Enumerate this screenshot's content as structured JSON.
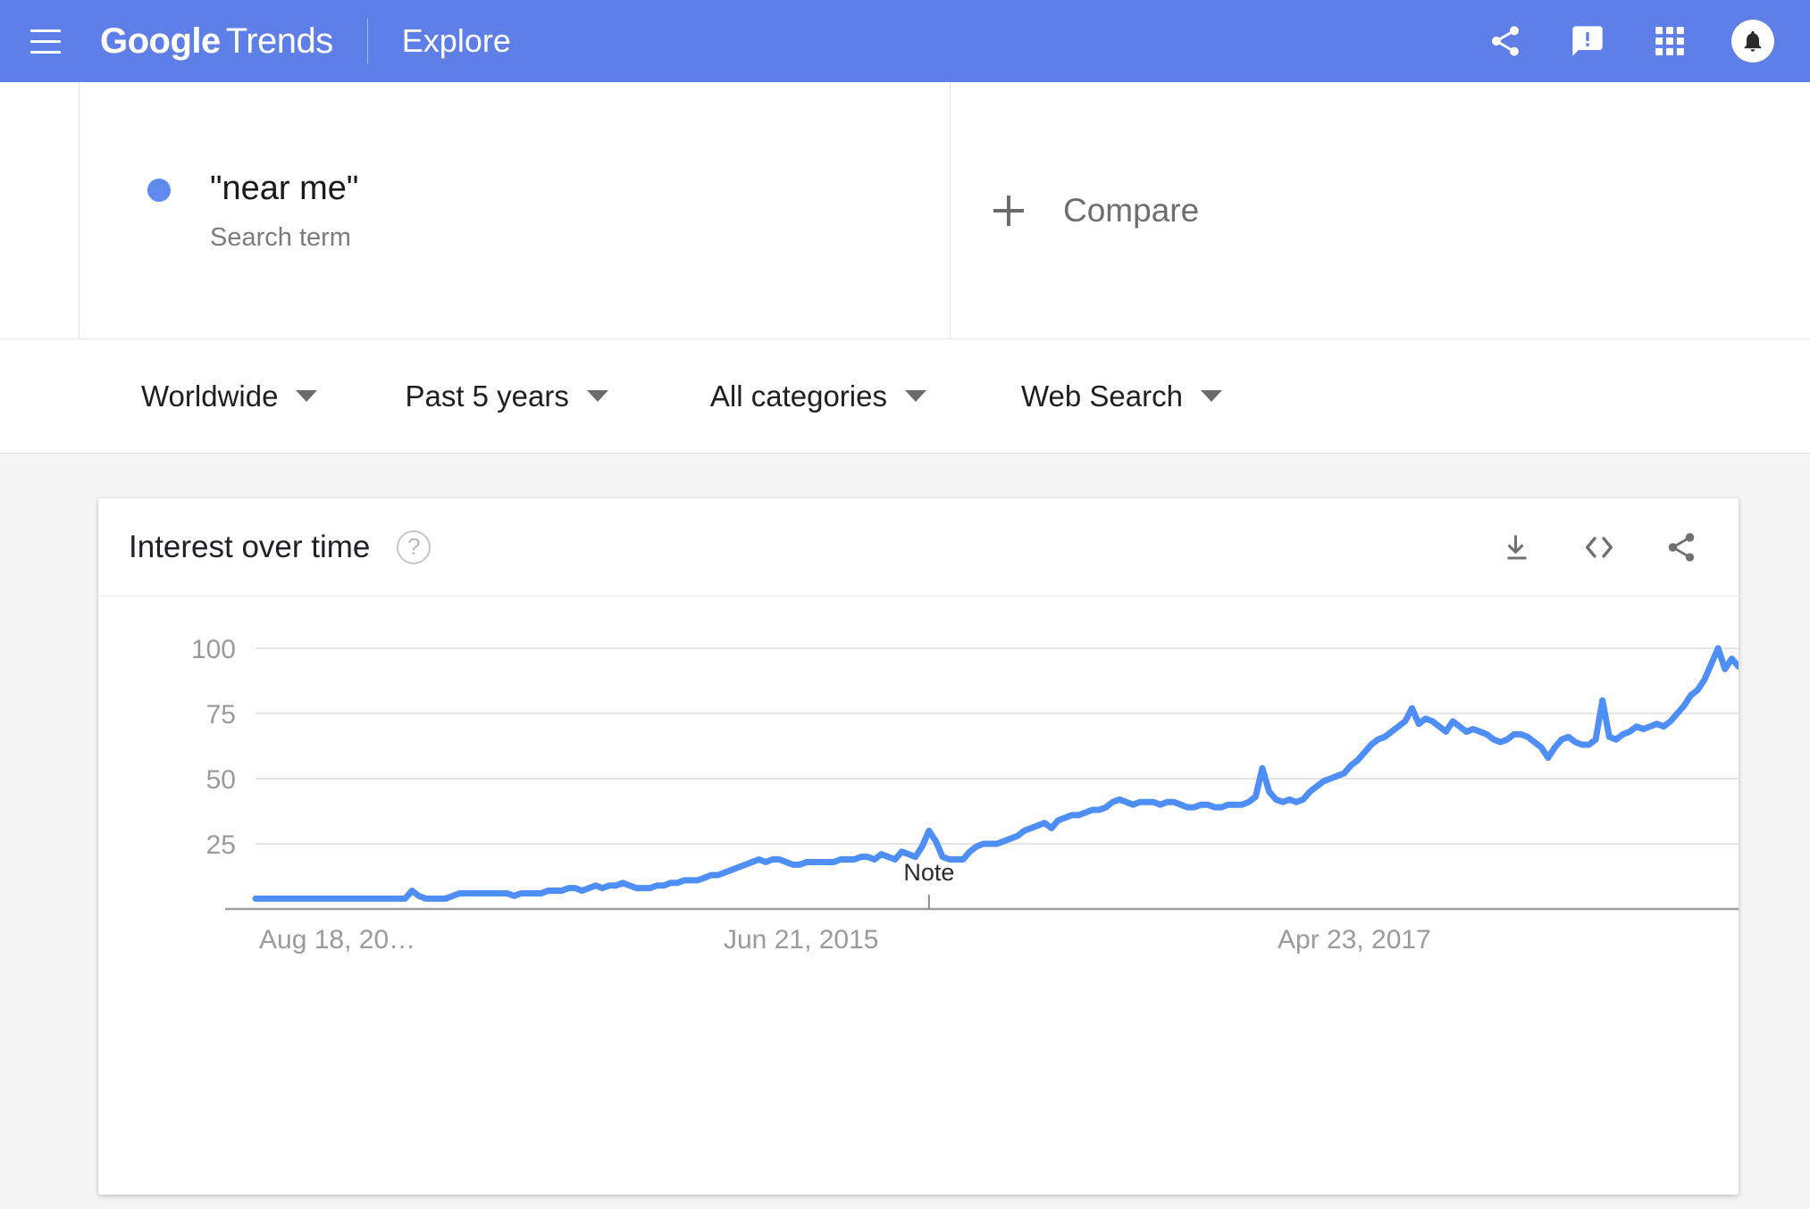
{
  "header": {
    "menu_icon": "hamburger-menu-icon",
    "brand_primary": "Google",
    "brand_secondary": "Trends",
    "section": "Explore",
    "icons": [
      "share-icon",
      "feedback-icon",
      "apps-grid-icon",
      "notifications-bell-icon"
    ],
    "background_color": "#5f7fe8"
  },
  "query": {
    "term": "\"near me\"",
    "type_label": "Search term",
    "dot_color": "#5f8bef",
    "compare_label": "Compare",
    "compare_plus_icon": "plus-icon"
  },
  "filters": [
    {
      "label": "Worldwide",
      "caret": "chevron-down-icon"
    },
    {
      "label": "Past 5 years",
      "caret": "chevron-down-icon"
    },
    {
      "label": "All categories",
      "caret": "chevron-down-icon"
    },
    {
      "label": "Web Search",
      "caret": "chevron-down-icon"
    }
  ],
  "card": {
    "title": "Interest over time",
    "help_icon": "help-circle-icon",
    "help_glyph": "?",
    "actions": [
      "download-icon",
      "embed-code-icon",
      "share-icon"
    ]
  },
  "chart_data": {
    "type": "line",
    "title": "Interest over time",
    "xlabel": "",
    "ylabel": "",
    "ylim": [
      0,
      100
    ],
    "yticks": [
      25,
      50,
      75,
      100
    ],
    "grid": true,
    "legend": false,
    "line_color": "#4e8ef7",
    "x_tick_labels": [
      "Aug 18, 20…",
      "Jun 21, 2015",
      "Apr 23, 2017"
    ],
    "annotations": [
      {
        "label": "Note",
        "x_index": 99
      }
    ],
    "series": [
      {
        "name": "\"near me\"",
        "values": [
          4,
          4,
          4,
          4,
          4,
          4,
          4,
          4,
          4,
          4,
          4,
          4,
          4,
          4,
          4,
          4,
          4,
          4,
          4,
          4,
          4,
          4,
          4,
          7,
          5,
          4,
          4,
          4,
          4,
          5,
          6,
          6,
          6,
          6,
          6,
          6,
          6,
          6,
          5,
          6,
          6,
          6,
          6,
          7,
          7,
          7,
          8,
          8,
          7,
          8,
          9,
          8,
          9,
          9,
          10,
          9,
          8,
          8,
          8,
          9,
          9,
          10,
          10,
          11,
          11,
          11,
          12,
          13,
          13,
          14,
          15,
          16,
          17,
          18,
          19,
          18,
          19,
          19,
          18,
          17,
          17,
          18,
          18,
          18,
          18,
          18,
          19,
          19,
          19,
          20,
          20,
          19,
          21,
          20,
          19,
          22,
          21,
          20,
          24,
          30,
          26,
          20,
          19,
          19,
          19,
          22,
          24,
          25,
          25,
          25,
          26,
          27,
          28,
          30,
          31,
          32,
          33,
          31,
          34,
          35,
          36,
          36,
          37,
          38,
          38,
          39,
          41,
          42,
          41,
          40,
          41,
          41,
          41,
          40,
          41,
          41,
          40,
          39,
          39,
          40,
          40,
          39,
          39,
          40,
          40,
          40,
          41,
          43,
          54,
          45,
          42,
          41,
          42,
          41,
          42,
          45,
          47,
          49,
          50,
          51,
          52,
          55,
          57,
          60,
          63,
          65,
          66,
          68,
          70,
          72,
          77,
          71,
          73,
          72,
          70,
          68,
          72,
          70,
          68,
          69,
          68,
          67,
          65,
          64,
          65,
          67,
          67,
          66,
          64,
          62,
          58,
          62,
          65,
          66,
          64,
          63,
          63,
          65,
          80,
          66,
          65,
          67,
          68,
          70,
          69,
          70,
          71,
          70,
          72,
          75,
          78,
          82,
          84,
          88,
          94,
          100,
          92,
          96,
          93
        ]
      }
    ]
  }
}
